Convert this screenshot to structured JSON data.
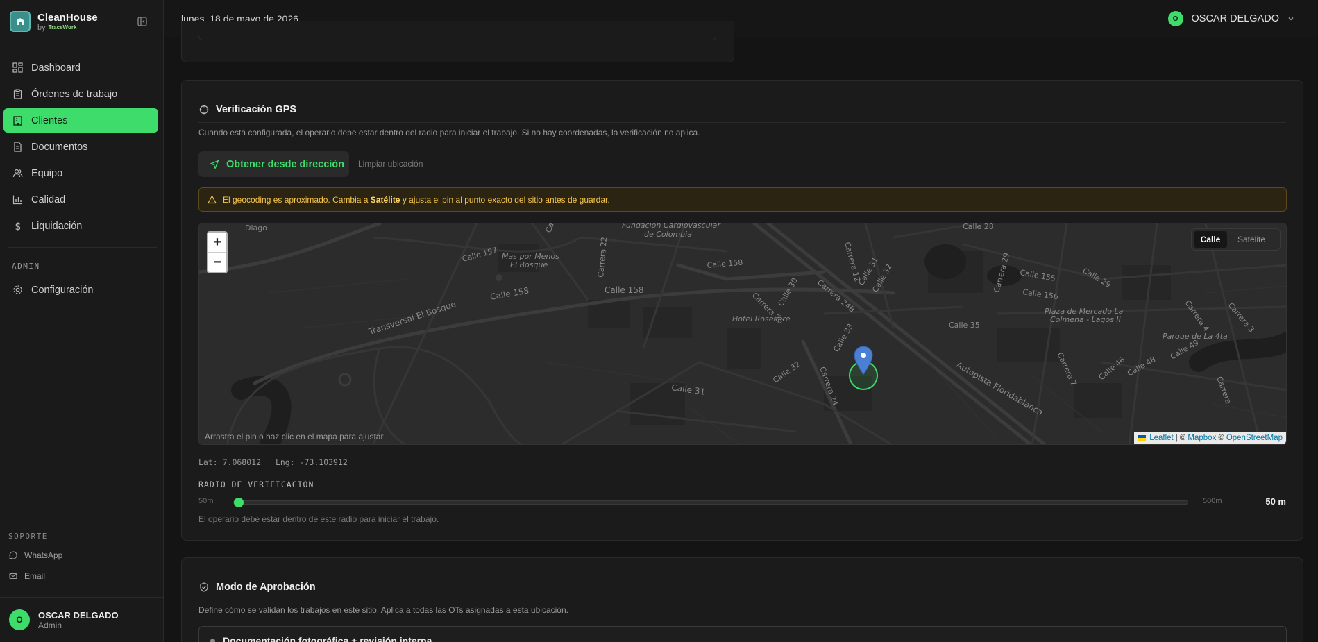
{
  "brand": {
    "name": "CleanHouse",
    "by": "by",
    "partner": "TraceWork"
  },
  "nav": {
    "items": [
      {
        "label": "Dashboard",
        "icon": "dashboard-icon"
      },
      {
        "label": "Órdenes de trabajo",
        "icon": "clipboard-icon"
      },
      {
        "label": "Clientes",
        "icon": "building-icon",
        "active": true
      },
      {
        "label": "Documentos",
        "icon": "document-icon"
      },
      {
        "label": "Equipo",
        "icon": "users-icon"
      },
      {
        "label": "Calidad",
        "icon": "bar-chart-icon"
      },
      {
        "label": "Liquidación",
        "icon": "dollar-icon"
      }
    ],
    "admin_title": "ADMIN",
    "admin_items": [
      {
        "label": "Configuración",
        "icon": "gear-icon"
      }
    ]
  },
  "support": {
    "title": "SOPORTE",
    "items": [
      {
        "label": "WhatsApp",
        "icon": "chat-icon"
      },
      {
        "label": "Email",
        "icon": "mail-icon"
      }
    ]
  },
  "user": {
    "initial": "O",
    "name": "OSCAR DELGADO",
    "role": "Admin"
  },
  "topbar": {
    "date": "lunes, 18 de mayo de 2026",
    "user_initial": "O",
    "user_name": "OSCAR DELGADO"
  },
  "gps": {
    "title": "Verificación GPS",
    "description": "Cuando está configurada, el operario debe estar dentro del radio para iniciar el trabajo. Si no hay coordenadas, la verificación no aplica.",
    "geo_button": "Obtener desde dirección",
    "clear_button": "Limpiar ubicación",
    "alert_pre": "El geocoding es aproximado. Cambia a ",
    "alert_bold": "Satélite",
    "alert_post": " y ajusta el pin al punto exacto del sitio antes de guardar.",
    "map": {
      "zoom_in": "+",
      "zoom_out": "−",
      "layer_street": "Calle",
      "layer_satellite": "Satélite",
      "hint": "Arrastra el pin o haz clic en el mapa para ajustar",
      "attrib_leaflet": "Leaflet",
      "attrib_sep1": "| ©",
      "attrib_mapbox": "Mapbox",
      "attrib_sep2": "©",
      "attrib_osm": "OpenStreetMap",
      "labels": {
        "fundacion": "Fundación Cardiovascular",
        "fundacion2": "de Colombia",
        "mas_por_menos": "Mas por Menos",
        "el_bosque": "El Bosque",
        "calle157": "Calle 157",
        "calle158a": "Calle 158",
        "calle158b": "Calle 158",
        "calle158c": "Calle 158",
        "transversal": "Transversal El Bosque",
        "hotel": "Hotel Roselière",
        "carrera22": "Carrera 22",
        "carrera12": "Carrera 12",
        "carrera24b": "Carrera 24B",
        "carrera25": "Carrera 25",
        "calle30": "Calle 30",
        "calle31a": "Calle 31",
        "calle32a": "Calle 32",
        "calle155": "Calle 155",
        "calle156": "Calle 156",
        "calle29": "Calle 29",
        "calle28": "Calle 28",
        "carrera29": "Carrera 29",
        "plaza": "Plaza de Mercado La",
        "plaza2": "Colmena - Lagos II",
        "calle35": "Calle 35",
        "autopista": "Autopista Floridablanca",
        "calle31b": "Calle 31",
        "calle32b": "Calle 32",
        "carrera24": "Carrera 24",
        "parque": "Parque de La 4ta",
        "carrera3": "Carrera 3",
        "carrera4": "Carrera 4",
        "carrera7": "Carrera 7",
        "calle46": "Calle 46",
        "calle48": "Calle 48",
        "calle49": "Calle 49",
        "carrera": "Carrera",
        "calle33": "Calle 33",
        "diago": "Diago",
        "cal": "Cal"
      }
    },
    "lat_label": "Lat: 7.068012",
    "lng_label": "Lng: -73.103912",
    "radius_title": "RADIO DE VERIFICACIÓN",
    "radius_min": "50m",
    "radius_max": "500m",
    "radius_value": "50 m",
    "radius_fraction": 0.0,
    "radius_help": "El operario debe estar dentro de este radio para iniciar el trabajo."
  },
  "approval": {
    "title": "Modo de Aprobación",
    "description": "Define cómo se validan los trabajos en este sitio. Aplica a todas las OTs asignadas a esta ubicación.",
    "option": "Documentación fotográfica + revisión interna"
  },
  "colors": {
    "accent": "#3ddc6b",
    "warning": "#f5c44a",
    "pin": "#4a7fd4"
  }
}
